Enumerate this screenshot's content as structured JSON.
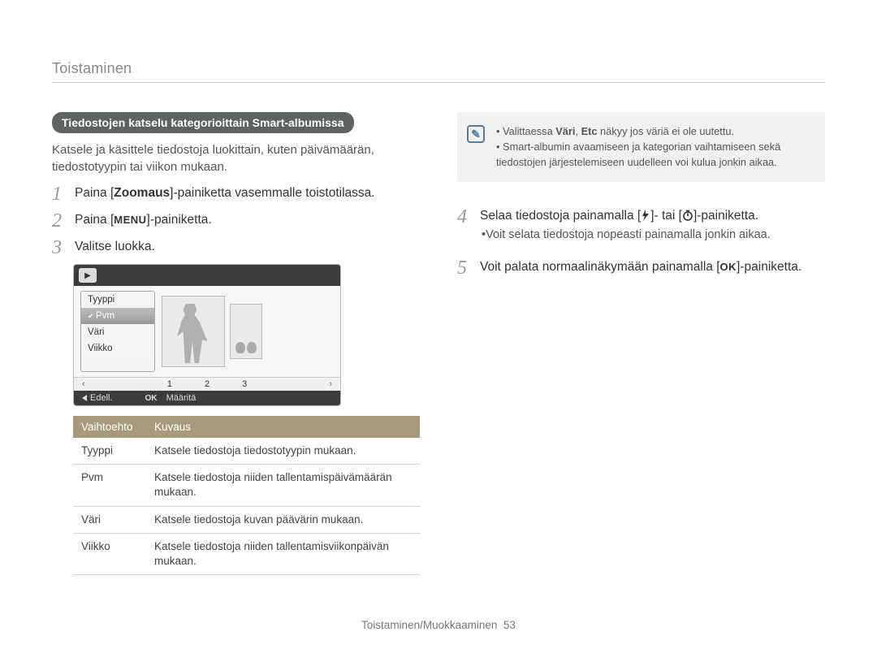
{
  "page_header": "Toistaminen",
  "section_pill": "Tiedostojen katselu kategorioittain Smart-albumissa",
  "intro": "Katsele ja käsittele tiedostoja luokittain, kuten päivämäärän, tiedostotyypin tai viikon mukaan.",
  "steps_left": {
    "s1_pre": "Paina [",
    "s1_bold": "Zoomaus",
    "s1_post": "]-painiketta vasemmalle toistotilassa.",
    "s2_pre": "Paina [",
    "s2_menu": "MENU",
    "s2_post": "]-painiketta.",
    "s3": "Valitse luokka."
  },
  "device": {
    "categories": [
      "Tyyppi",
      "Pvm",
      "Väri",
      "Viikko"
    ],
    "selected_index": 1,
    "pager": [
      "1",
      "2",
      "3"
    ],
    "back_label": "Edell.",
    "ok_glyph": "OK",
    "set_label": "Määritä"
  },
  "table": {
    "head_option": "Vaihtoehto",
    "head_desc": "Kuvaus",
    "rows": [
      {
        "k": "Tyyppi",
        "v": "Katsele tiedostoja tiedostotyypin mukaan."
      },
      {
        "k": "Pvm",
        "v": "Katsele tiedostoja niiden tallentamispäivämäärän mukaan."
      },
      {
        "k": "Väri",
        "v": "Katsele tiedostoja kuvan päävärin mukaan."
      },
      {
        "k": "Viikko",
        "v": "Katsele tiedostoja niiden tallentamisviikonpäivän mukaan."
      }
    ]
  },
  "note": {
    "line1_pre": "Valittaessa ",
    "line1_b1": "Väri",
    "line1_mid": ", ",
    "line1_b2": "Etc",
    "line1_post": " näkyy jos väriä ei ole uutettu.",
    "line2": "Smart-albumin avaamiseen ja kategorian vaihtamiseen sekä tiedostojen järjestelemiseen uudelleen voi kulua jonkin aikaa."
  },
  "steps_right": {
    "s4_pre": "Selaa tiedostoja painamalla [",
    "s4_mid": "]- tai [",
    "s4_post": "]-painiketta.",
    "s4_sub": "Voit selata tiedostoja nopeasti painamalla jonkin aikaa.",
    "s5_pre": "Voit palata normaalinäkymään painamalla ",
    "s5_ok": "OK",
    "s5_post": "-painiketta."
  },
  "footer_label": "Toistaminen/Muokkaaminen",
  "footer_page": "53"
}
